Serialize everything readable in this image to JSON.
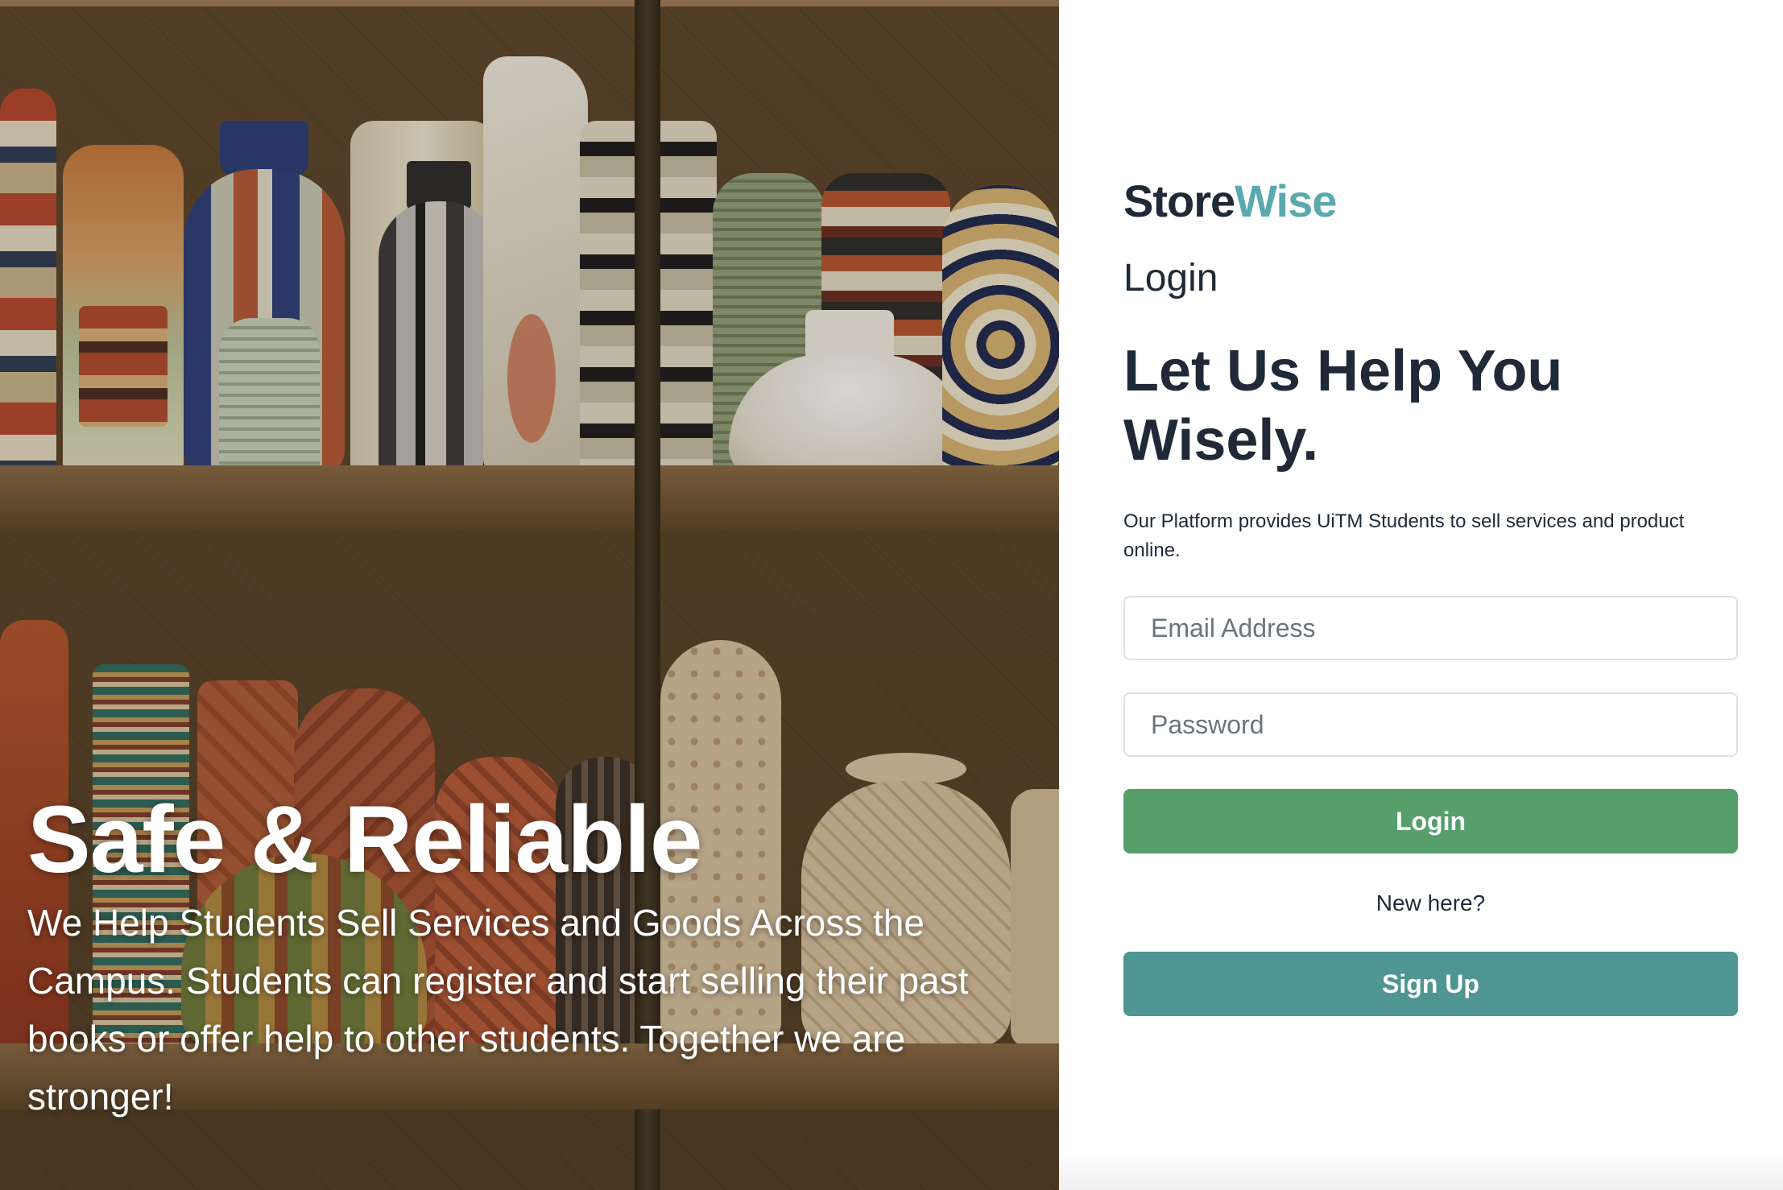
{
  "hero": {
    "title": "Safe & Reliable",
    "text": "We Help Students Sell Services and Goods Across the Campus. Students can register and start selling their past books or offer help to other students. Together we are stronger!"
  },
  "brand": {
    "part1": "Store",
    "part2": "Wise",
    "accent_color": "#5aa8b0"
  },
  "login": {
    "heading": "Login",
    "headline": "Let Us Help You Wisely.",
    "subtext": "Our Platform provides UiTM Students to sell services and product online.",
    "email_placeholder": "Email Address",
    "password_placeholder": "Password",
    "login_button": "Login",
    "new_here": "New here?",
    "signup_button": "Sign Up"
  },
  "colors": {
    "login_button": "#569f6b",
    "signup_button": "#4f9592",
    "text_dark": "#1f2937"
  }
}
